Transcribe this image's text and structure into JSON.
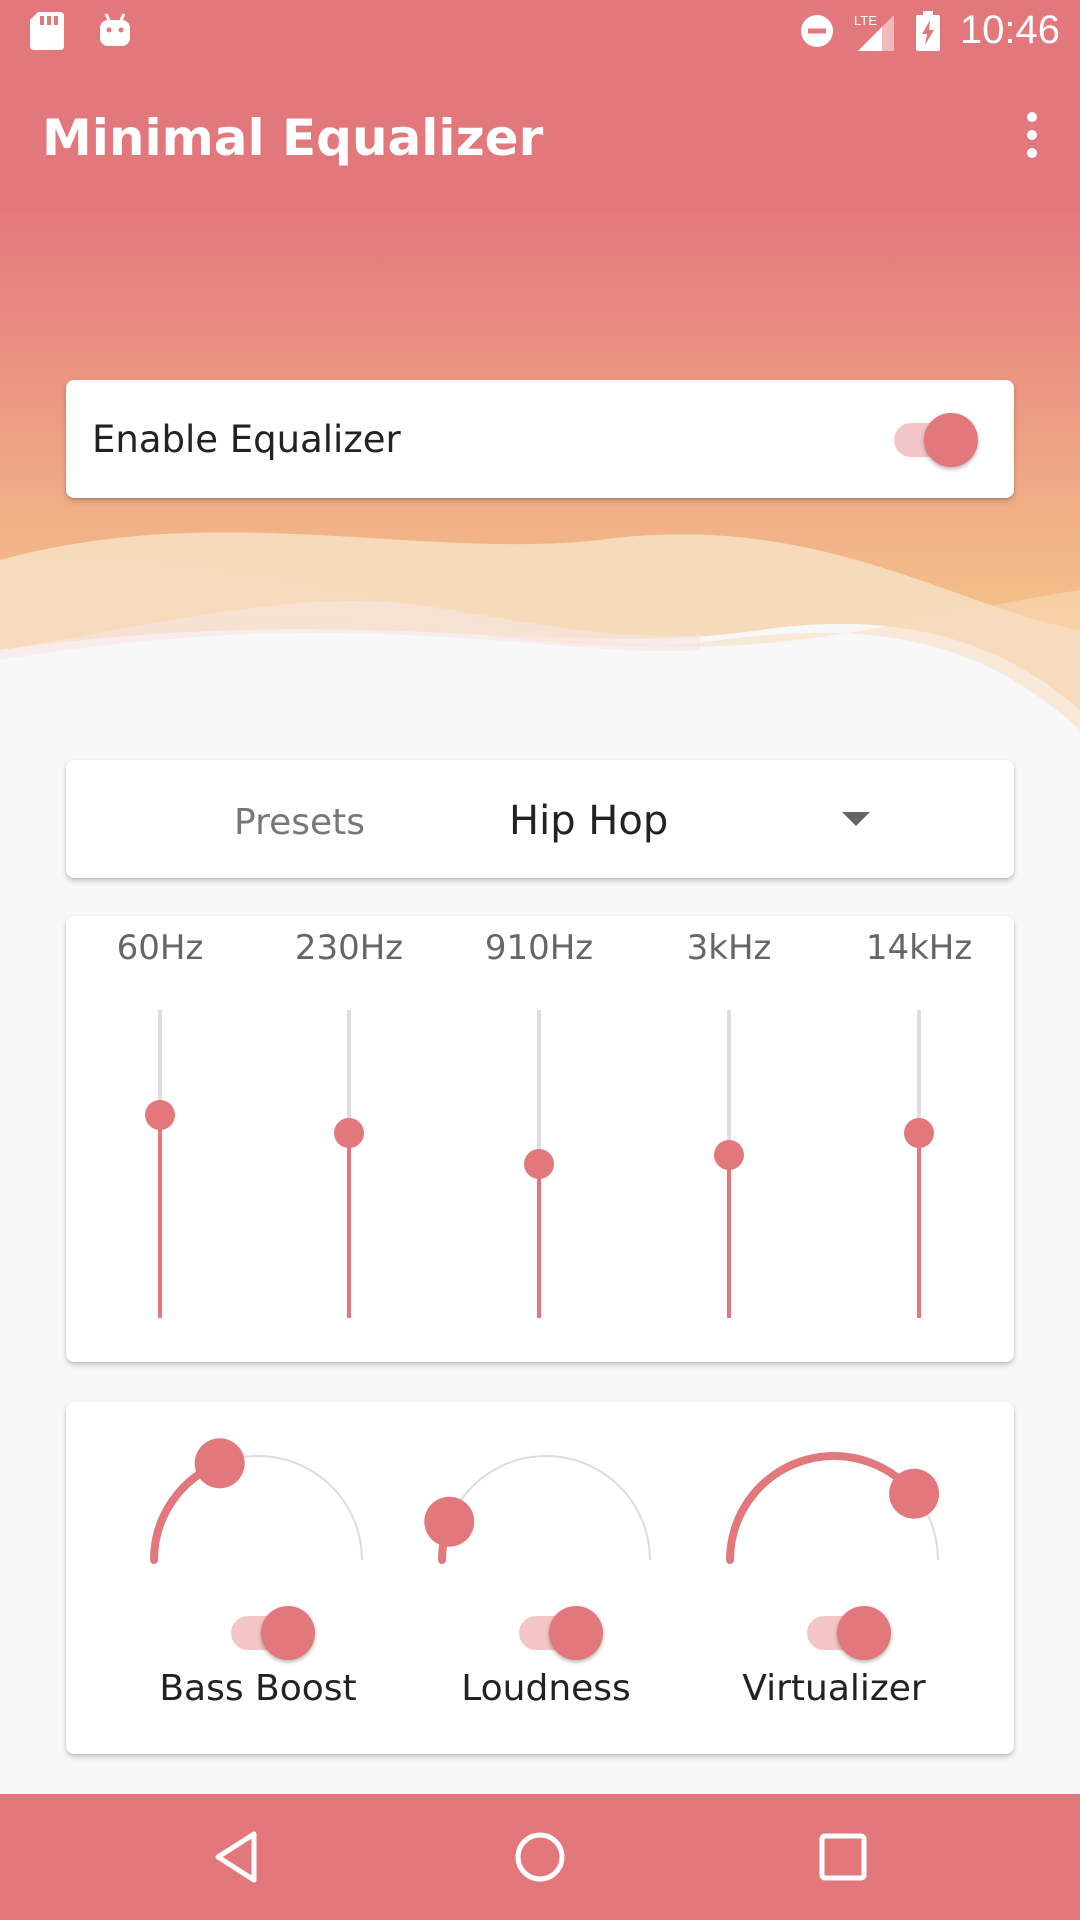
{
  "status_bar": {
    "time": "10:46",
    "network": "LTE",
    "icons": [
      "sd-card-icon",
      "android-icon",
      "do-not-disturb-icon",
      "signal-icon",
      "battery-charging-icon"
    ]
  },
  "app_bar": {
    "title": "Minimal Equalizer",
    "menu_icon": "more-vert-icon"
  },
  "enable_card": {
    "label": "Enable Equalizer",
    "enabled": true
  },
  "presets": {
    "label": "Presets",
    "selected": "Hip Hop",
    "dropdown_icon": "arrow-drop-down-icon"
  },
  "equalizer": {
    "bands": [
      {
        "label": "60Hz",
        "level": 0.66
      },
      {
        "label": "230Hz",
        "level": 0.6
      },
      {
        "label": "910Hz",
        "level": 0.5
      },
      {
        "label": "3kHz",
        "level": 0.53
      },
      {
        "label": "14kHz",
        "level": 0.6
      }
    ]
  },
  "effects": [
    {
      "label": "Bass Boost",
      "enabled": true,
      "level": 0.38
    },
    {
      "label": "Loudness",
      "enabled": true,
      "level": 0.12
    },
    {
      "label": "Virtualizer",
      "enabled": true,
      "level": 0.78
    }
  ],
  "colors": {
    "accent": "#e2777c",
    "track": "#dedede",
    "switch_track": "#f4c6c8",
    "hero_top": "#e5787f",
    "hero_bottom": "#f4c289"
  },
  "nav_bar": {
    "buttons": [
      "back-icon",
      "home-icon",
      "recents-icon"
    ]
  }
}
